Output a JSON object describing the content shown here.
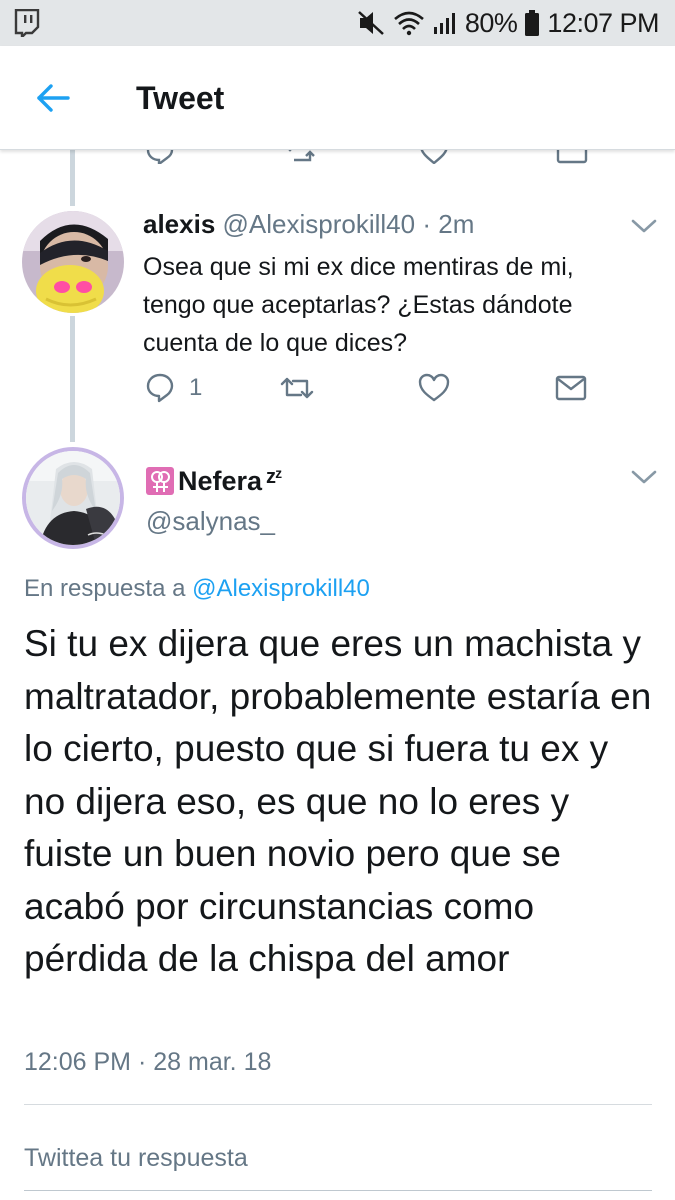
{
  "status_bar": {
    "battery": "80%",
    "time": "12:07 PM"
  },
  "header": {
    "title": "Tweet"
  },
  "reply_tweet": {
    "name": "alexis",
    "handle": "@Alexisprokill40",
    "separator": "·",
    "age": "2m",
    "text": "Osea que si mi ex dice mentiras de mi, tengo que aceptarlas? ¿Estas dándote cuenta de lo que dices?",
    "reply_count": "1"
  },
  "main_tweet": {
    "name": "Nefera",
    "name_suffix": "zᶻ",
    "handle": "@salynas_",
    "reply_prefix": "En respuesta a",
    "reply_to": "@Alexisprokill40",
    "text": "Si tu ex dijera que eres un machista y maltratador, probablemente estaría en lo cierto, puesto que si fuera tu ex y no dijera eso, es que no lo eres y fuiste un buen novio pero que se acabó por circunstancias como pérdida de la chispa del amor",
    "time": "12:06 PM",
    "date": "28 mar. 18"
  },
  "composer": {
    "placeholder": "Twittea tu respuesta"
  },
  "colors": {
    "accent": "#1da1f2",
    "secondary_text": "#657786",
    "thread_line": "#ccd6dd"
  },
  "icons": [
    "app-notification-icon",
    "mute-icon",
    "wifi-icon",
    "signal-icon",
    "battery-icon",
    "back-arrow-icon",
    "reply-icon",
    "retweet-icon",
    "like-icon",
    "message-icon",
    "chevron-down-icon",
    "female-symbol-icon"
  ]
}
